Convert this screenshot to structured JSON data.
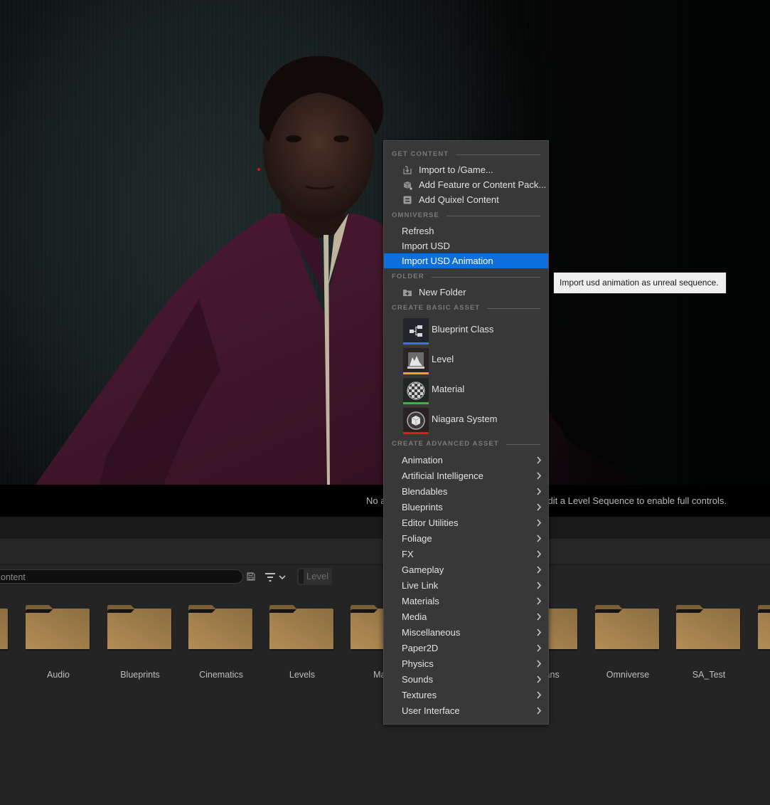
{
  "viewport": {
    "sequencer_message_visible_left": "No a",
    "sequencer_message_visible_right": "edit a Level Sequence to enable full controls."
  },
  "content_browser": {
    "search_value_visible": "ontent",
    "filter_chip": "Level",
    "folders": [
      {
        "name": ""
      },
      {
        "name": "Audio"
      },
      {
        "name": "Blueprints"
      },
      {
        "name": "Cinematics"
      },
      {
        "name": "Levels"
      },
      {
        "name": "Mate"
      },
      {
        "name": "umans"
      },
      {
        "name": "Omniverse"
      },
      {
        "name": "SA_Test"
      },
      {
        "name": ""
      }
    ]
  },
  "context_menu": {
    "sections": {
      "get_content": "GET CONTENT",
      "omniverse": "OMNIVERSE",
      "folder": "FOLDER",
      "create_basic_asset": "CREATE BASIC ASSET",
      "create_advanced_asset": "CREATE ADVANCED ASSET"
    },
    "get_content_items": [
      {
        "label": "Import to /Game...",
        "icon": "import-icon"
      },
      {
        "label": "Add Feature or Content Pack...",
        "icon": "feature-pack-icon"
      },
      {
        "label": "Add Quixel Content",
        "icon": "quixel-icon"
      }
    ],
    "omniverse_items": [
      {
        "label": "Refresh"
      },
      {
        "label": "Import USD"
      },
      {
        "label": "Import USD Animation",
        "highlighted": true
      }
    ],
    "folder_items": [
      {
        "label": "New Folder",
        "icon": "new-folder-icon"
      }
    ],
    "basic_assets": [
      {
        "label": "Blueprint Class",
        "icon": "blueprint-class-icon",
        "color": "#3f6fe0"
      },
      {
        "label": "Level",
        "icon": "level-icon",
        "color": "#f0a020"
      },
      {
        "label": "Material",
        "icon": "material-icon",
        "color": "#40b040"
      },
      {
        "label": "Niagara System",
        "icon": "niagara-system-icon",
        "color": "#e01818"
      }
    ],
    "advanced_assets": [
      {
        "label": "Animation"
      },
      {
        "label": "Artificial Intelligence"
      },
      {
        "label": "Blendables"
      },
      {
        "label": "Blueprints"
      },
      {
        "label": "Editor Utilities"
      },
      {
        "label": "Foliage"
      },
      {
        "label": "FX"
      },
      {
        "label": "Gameplay"
      },
      {
        "label": "Live Link"
      },
      {
        "label": "Materials"
      },
      {
        "label": "Media"
      },
      {
        "label": "Miscellaneous"
      },
      {
        "label": "Paper2D"
      },
      {
        "label": "Physics"
      },
      {
        "label": "Sounds"
      },
      {
        "label": "Textures"
      },
      {
        "label": "User Interface"
      }
    ],
    "highlight_color": "#0e6fdc"
  },
  "tooltip": {
    "text": "Import usd animation as unreal sequence."
  }
}
